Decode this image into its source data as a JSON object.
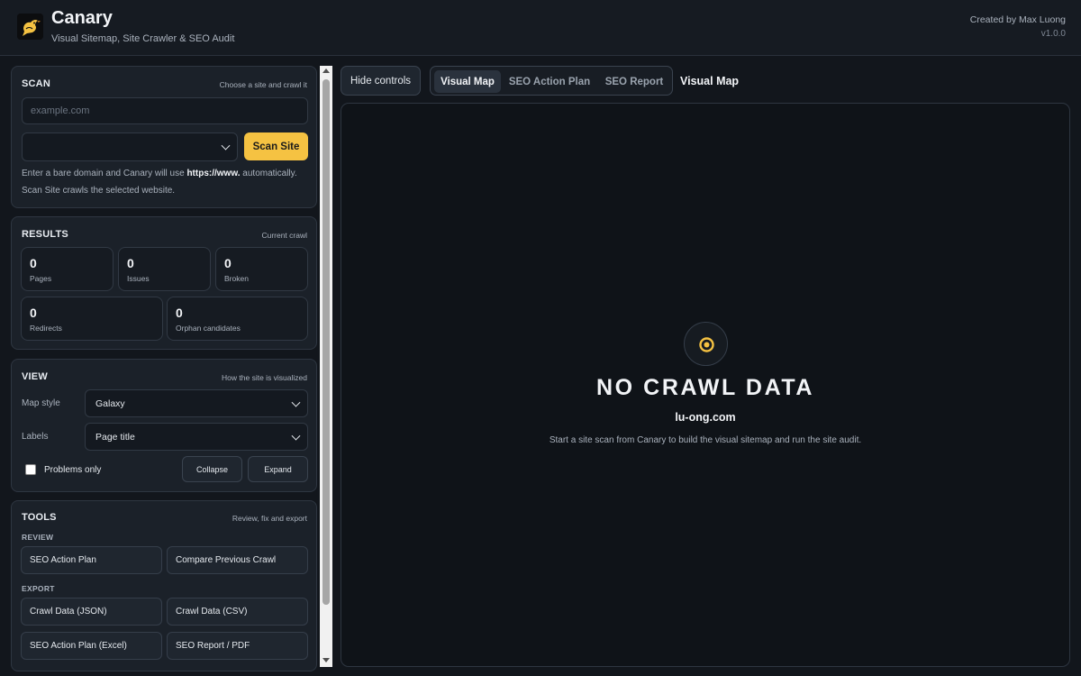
{
  "header": {
    "title": "Canary",
    "subtitle": "Visual Sitemap, Site Crawler & SEO Audit",
    "credit": "Created by Max Luong",
    "version": "v1.0.0",
    "logo_icon": "canary-bird-icon"
  },
  "scan": {
    "title": "SCAN",
    "hint": "Choose a site and crawl it",
    "input_value": "",
    "input_placeholder": "example.com",
    "select_value": "",
    "button_label": "Scan Site",
    "help_prefix": "Enter a bare domain and Canary will use ",
    "help_bold": "https://www.",
    "help_suffix": " automatically.",
    "help_line2": "Scan Site crawls the selected website."
  },
  "results": {
    "title": "RESULTS",
    "hint": "Current crawl",
    "stats": [
      {
        "value": "0",
        "label": "Pages"
      },
      {
        "value": "0",
        "label": "Issues"
      },
      {
        "value": "0",
        "label": "Broken"
      },
      {
        "value": "0",
        "label": "Redirects"
      },
      {
        "value": "0",
        "label": "Orphan candidates"
      }
    ]
  },
  "view": {
    "title": "VIEW",
    "hint": "How the site is visualized",
    "map_style_label": "Map style",
    "map_style_value": "Galaxy",
    "labels_label": "Labels",
    "labels_value": "Page title",
    "problems_only_label": "Problems only",
    "problems_only_checked": false,
    "collapse_label": "Collapse",
    "expand_label": "Expand"
  },
  "tools": {
    "title": "TOOLS",
    "hint": "Review, fix and export",
    "review_title": "REVIEW",
    "review_buttons": [
      "SEO Action Plan",
      "Compare Previous Crawl"
    ],
    "export_title": "EXPORT",
    "export_buttons": [
      "Crawl Data (JSON)",
      "Crawl Data (CSV)",
      "SEO Action Plan (Excel)",
      "SEO Report / PDF"
    ]
  },
  "main": {
    "hide_controls_label": "Hide controls",
    "tabs": [
      {
        "label": "Visual Map",
        "active": true
      },
      {
        "label": "SEO Action Plan",
        "active": false
      },
      {
        "label": "SEO Report",
        "active": false
      }
    ],
    "view_title": "Visual Map",
    "empty_icon": "radar-target-icon",
    "empty_title": "NO CRAWL DATA",
    "empty_domain": "lu-ong.com",
    "empty_message": "Start a site scan from Canary to build the visual sitemap and run the site audit."
  },
  "colors": {
    "accent": "#f5c242",
    "background": "#12161c",
    "panel": "#1b2129",
    "canvas": "#0f1318"
  }
}
